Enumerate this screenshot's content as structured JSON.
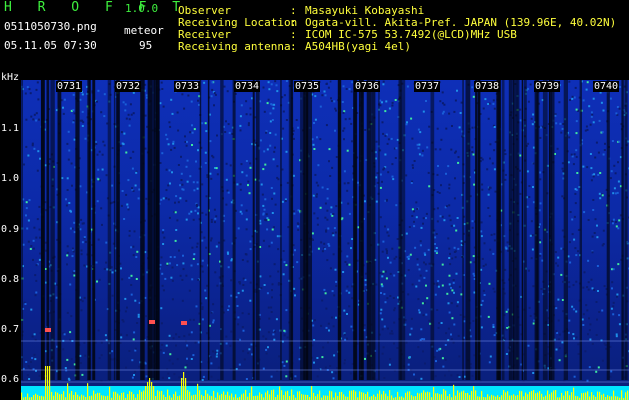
{
  "app": {
    "title": "H R O F F T",
    "version": "1.0.0"
  },
  "file": {
    "name": "0511050730.png",
    "datetime": "05.11.05 07:30"
  },
  "meteor": {
    "label": "meteor",
    "count": "95"
  },
  "info": [
    {
      "key": "Observer",
      "value": "Masayuki Kobayashi"
    },
    {
      "key": "Receiving Location",
      "value": "Ogata-vill. Akita-Pref. JAPAN (139.96E, 40.02N)"
    },
    {
      "key": "Receiver",
      "value": "ICOM IC-575 53.7492(@LCD)MHz USB"
    },
    {
      "key": "Receiving antenna",
      "value": "A504HB(yagi 4el)"
    }
  ],
  "separator": ":",
  "axis": {
    "unit": "kHz",
    "y_ticks": [
      "1.1",
      "1.0",
      "0.9",
      "0.8",
      "0.7",
      "0.6"
    ],
    "x_ticks": [
      "0731",
      "0732",
      "0733",
      "0734",
      "0735",
      "0736",
      "0737",
      "0738",
      "0739",
      "0740"
    ]
  },
  "colors": {
    "title": "#3ef03e",
    "info": "#ffff3c",
    "signal": "#ffff00",
    "baseline": "#00e5ff"
  }
}
